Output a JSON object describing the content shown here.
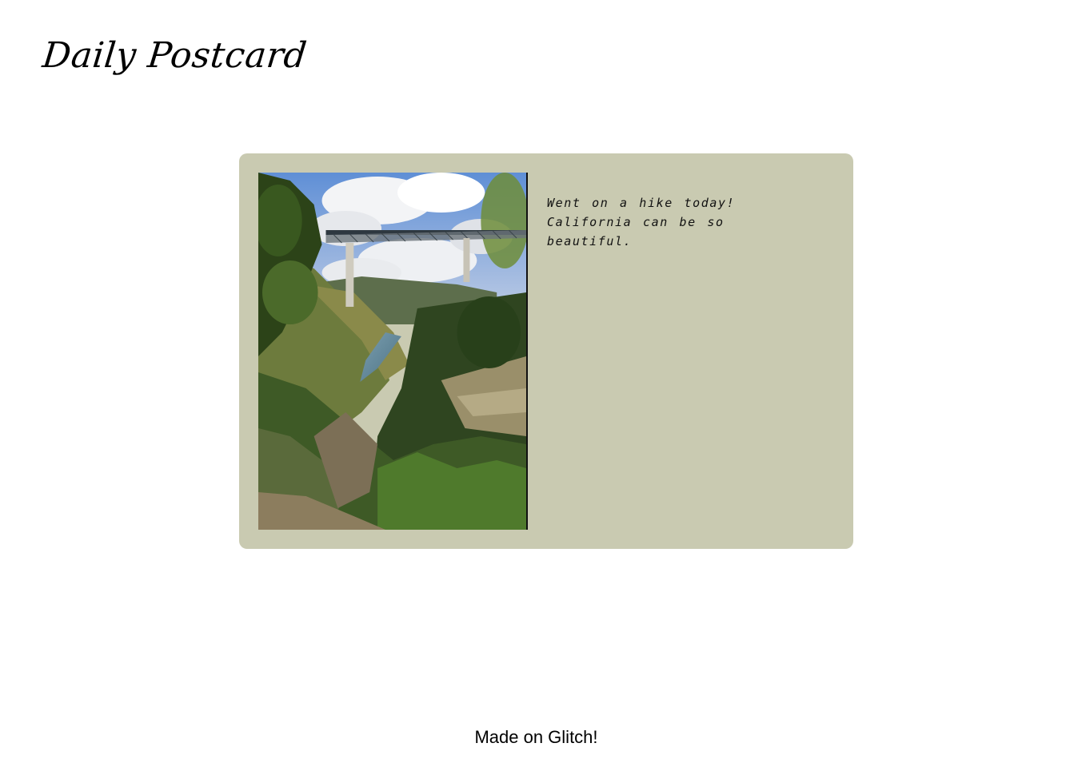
{
  "header": {
    "title": "Daily Postcard"
  },
  "postcard": {
    "photo_icon": "landscape-photo-bridge-canyon",
    "message": "Went on a hike today! California can be so beautiful.",
    "background_color": "#c9cab1"
  },
  "footer": {
    "text": "Made on Glitch!"
  }
}
